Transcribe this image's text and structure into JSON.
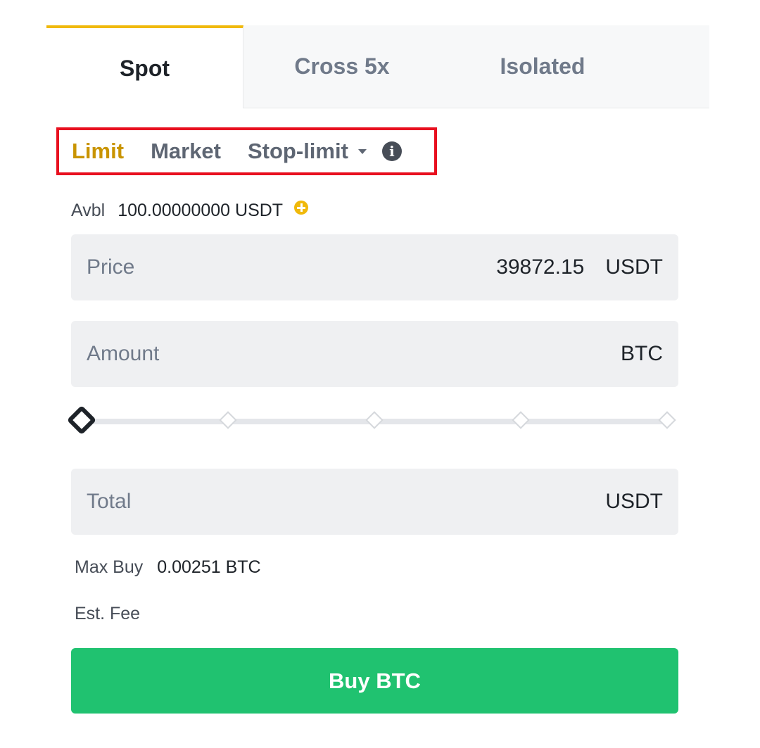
{
  "tabs": [
    {
      "label": "Spot",
      "active": true
    },
    {
      "label": "Cross 5x",
      "active": false
    },
    {
      "label": "Isolated",
      "active": false
    }
  ],
  "order_types": {
    "limit": "Limit",
    "market": "Market",
    "stop_limit": "Stop-limit",
    "active": "Limit",
    "info_icon_glyph": "i"
  },
  "available": {
    "label": "Avbl",
    "value": "100.00000000 USDT"
  },
  "fields": {
    "price": {
      "label": "Price",
      "value": "39872.15",
      "unit": "USDT"
    },
    "amount": {
      "label": "Amount",
      "value": "",
      "unit": "BTC"
    },
    "total": {
      "label": "Total",
      "value": "",
      "unit": "USDT"
    }
  },
  "slider": {
    "percent": 0,
    "steps": [
      0,
      25,
      50,
      75,
      100
    ]
  },
  "max_buy": {
    "label": "Max Buy",
    "value": "0.00251 BTC"
  },
  "est_fee": {
    "label": "Est. Fee",
    "value": ""
  },
  "buy_button": {
    "label": "Buy BTC"
  },
  "colors": {
    "accent": "#f0b90b",
    "active_order_type": "#c99400",
    "buy": "#20c270",
    "highlight_box": "#e8101f"
  },
  "icons": [
    "plus-circle-icon",
    "info-icon",
    "caret-down-icon"
  ]
}
